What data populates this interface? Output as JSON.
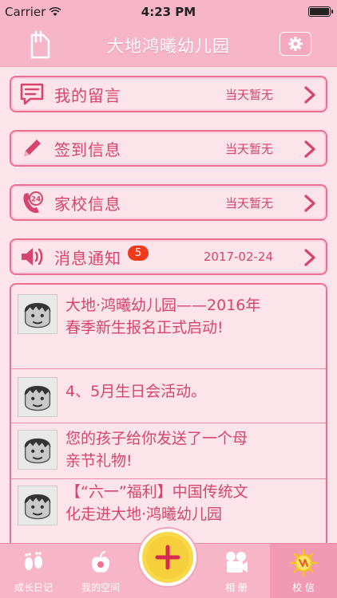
{
  "status": {
    "carrier": "Carrier",
    "time": "4:23 PM"
  },
  "nav": {
    "title": "大地鸿曦幼儿园"
  },
  "rows": [
    {
      "label": "我的留言",
      "value": "当天暂无"
    },
    {
      "label": "签到信息",
      "value": "当天暂无"
    },
    {
      "label": "家校信息",
      "value": "当天暂无"
    },
    {
      "label": "消息通知",
      "value": "2017-02-24",
      "badge": "5"
    }
  ],
  "messages": [
    {
      "text": "大地·鸿曦幼儿园——2016年春季新生报名正式启动!"
    },
    {
      "text": "4、5月生日会活动。"
    },
    {
      "text": "您的孩子给你发送了一个母亲节礼物!"
    },
    {
      "text": "【“六一”福利】中国传统文化走进大地·鸿曦幼儿园"
    }
  ],
  "tabs": [
    {
      "label": "成长日记"
    },
    {
      "label": "我的空间"
    },
    {
      "label": "相 册"
    },
    {
      "label": "校 信"
    }
  ],
  "colors": {
    "accent": "#d6456d",
    "border": "#ec6f92",
    "bar": "#f7b6c8",
    "background": "#fde3ea"
  }
}
